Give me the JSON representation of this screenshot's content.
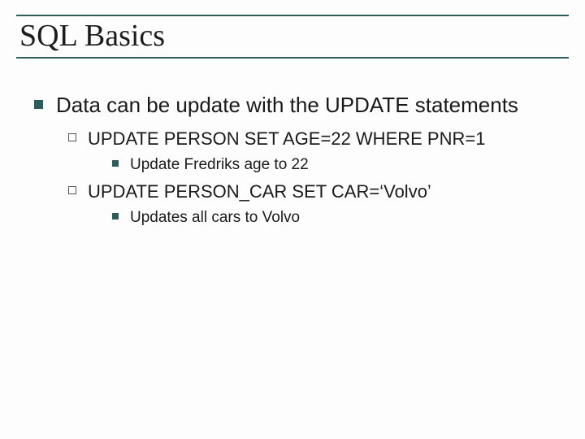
{
  "slide": {
    "title": "SQL Basics",
    "l1": "Data can be update with the UPDATE statements",
    "l2a": "UPDATE PERSON SET AGE=22 WHERE PNR=1",
    "l3a": "Update Fredriks age to 22",
    "l2b": "UPDATE PERSON_CAR SET CAR=‘Volvo’",
    "l3b": "Updates all cars to Volvo"
  }
}
